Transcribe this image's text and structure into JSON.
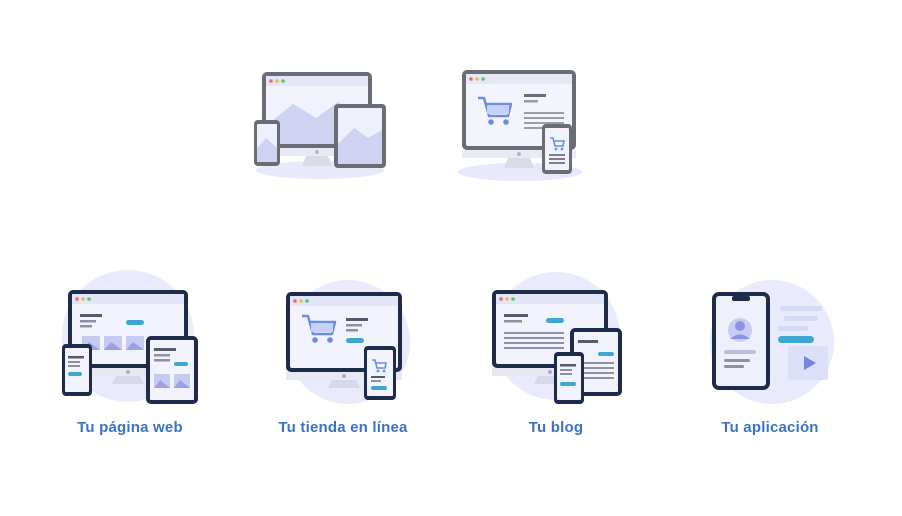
{
  "colors": {
    "caption": "#3a73c4",
    "screen_frame_dark": "#1f2b4a",
    "screen_frame_gray": "#5f6368",
    "accent_blue": "#3fa7cf",
    "cart_blue": "#6b8fe0",
    "halo": "#e7e8fb",
    "screen_bg": "#eceefc",
    "mountain": "#c9cdf2"
  },
  "icons": [
    "responsive-devices-gray-icon",
    "ecommerce-devices-gray-icon",
    "web-page-devices-icon",
    "online-store-devices-icon",
    "blog-devices-icon",
    "mobile-app-icon"
  ],
  "services": [
    {
      "label": "Tu página web"
    },
    {
      "label": "Tu tienda en línea"
    },
    {
      "label": "Tu blog"
    },
    {
      "label": "Tu aplicación"
    }
  ]
}
